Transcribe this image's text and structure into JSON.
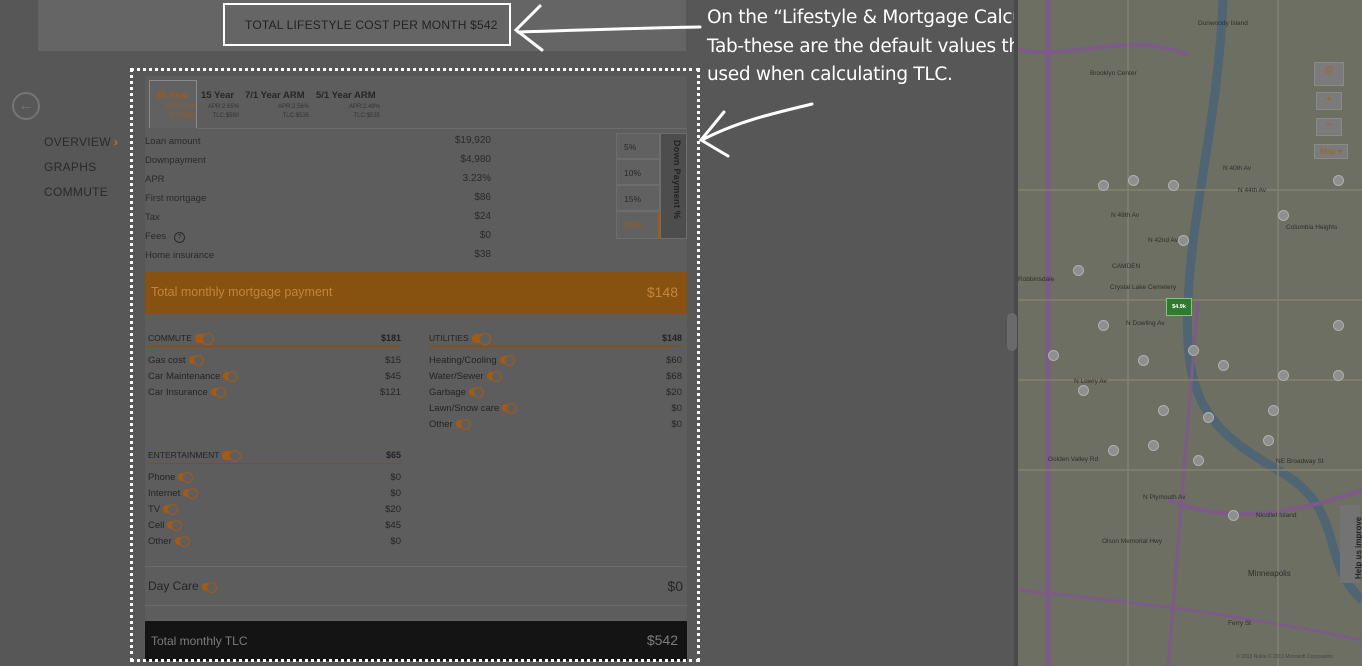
{
  "header": {
    "tlc_summary": "TOTAL LIFESTYLE COST PER MONTH $542"
  },
  "nav": {
    "back_icon": "←",
    "items": [
      {
        "label": "OVERVIEW",
        "active": true,
        "arrow": "›"
      },
      {
        "label": "GRAPHS"
      },
      {
        "label": "COMMUTE"
      }
    ]
  },
  "terms": [
    {
      "name": "30 Year",
      "apr": "APR:3.23%",
      "tlc": "TLC:$542",
      "selected": true
    },
    {
      "name": "15 Year",
      "apr": "APR:2.65%",
      "tlc": "TLC:$590"
    },
    {
      "name": "7/1 Year ARM",
      "apr": "APR:2.56%",
      "tlc": "TLC:$535"
    },
    {
      "name": "5/1 Year ARM",
      "apr": "APR:2.49%",
      "tlc": "TLC:$535"
    }
  ],
  "loan_rows": [
    {
      "label": "Loan amount",
      "value": "$19,920"
    },
    {
      "label": "Downpayment",
      "value": "$4,980"
    },
    {
      "label": "APR",
      "value": "3.23%"
    },
    {
      "label": "First mortgage",
      "value": "$86"
    },
    {
      "label": "Tax",
      "value": "$24"
    },
    {
      "label": "Fees",
      "value": "$0",
      "help": "?"
    },
    {
      "label": "Home insurance",
      "value": "$38"
    }
  ],
  "down_payment": {
    "title": "Down Payment %",
    "options": [
      "5%",
      "10%",
      "15%",
      "20%"
    ],
    "selected": "20%"
  },
  "mortgage_total": {
    "label": "Total monthly mortgage payment",
    "value": "$148"
  },
  "commute": {
    "title": "COMMUTE",
    "total": "$181",
    "items": [
      {
        "label": "Gas cost",
        "value": "$15"
      },
      {
        "label": "Car Maintenance",
        "value": "$45"
      },
      {
        "label": "Car Insurance",
        "value": "$121"
      }
    ]
  },
  "utilities": {
    "title": "UTILITIES",
    "total": "$148",
    "items": [
      {
        "label": "Heating/Cooling",
        "value": "$60"
      },
      {
        "label": "Water/Sewer",
        "value": "$68"
      },
      {
        "label": "Garbage",
        "value": "$20"
      },
      {
        "label": "Lawn/Snow care",
        "value": "$0"
      },
      {
        "label": "Other",
        "value": "$0"
      }
    ]
  },
  "entertainment": {
    "title": "ENTERTAINMENT",
    "total": "$65",
    "items": [
      {
        "label": "Phone",
        "value": "$0"
      },
      {
        "label": "Internet",
        "value": "$0"
      },
      {
        "label": "TV",
        "value": "$20"
      },
      {
        "label": "Cell",
        "value": "$45"
      },
      {
        "label": "Other",
        "value": "$0"
      }
    ]
  },
  "daycare": {
    "label": "Day Care",
    "value": "$0"
  },
  "tlc_total": {
    "label": "Total monthly TLC",
    "value": "$542"
  },
  "annotation": {
    "lines": [
      "On the “Lifestyle & Mortgage Calculator”",
      "Tab-these are the default values that are",
      "used when calculating TLC."
    ]
  },
  "map": {
    "labels": [
      "Dunwoody Island",
      "Brooklyn Center",
      "Columbia Heights",
      "N 49th Av",
      "N 42nd Av",
      "N 44th Av",
      "CAMDEN",
      "Crystal Lake Cemetery",
      "N Lowry Av",
      "Olson Memorial Hwy",
      "NE Broadway St",
      "Minneapolis",
      "N Plymouth Av",
      "Nicollet Island",
      "Golden Valley Rd",
      "Robbinsdale",
      "N Dowling Av",
      "N 40th Av",
      "Ferry St"
    ],
    "zoom_in": "+",
    "zoom_out": "−",
    "map_type": "Map ▾",
    "home_price": "$4.9k",
    "help": "Help us improve",
    "copyright": "© 2013 Nokia   © 2013 Microsoft Corporation",
    "colors": {
      "land": "#6d6f63",
      "water": "#4f6573",
      "highway": "#7d5a88",
      "road": "#85806e"
    }
  },
  "colors": {
    "accent": "#a35a15",
    "mortgage_bar": "#87510f",
    "tlc_bar": "#141414"
  }
}
